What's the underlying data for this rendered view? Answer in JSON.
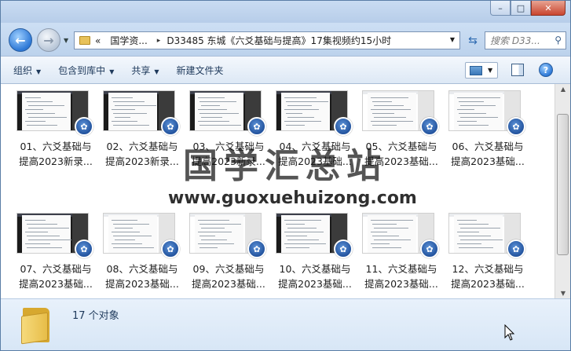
{
  "window": {
    "caption_buttons": {
      "minimize": "–",
      "maximize": "□",
      "close": "✕"
    }
  },
  "nav": {
    "back_icon": "←",
    "forward_icon": "→",
    "breadcrumbs": [
      "«",
      "国学资...",
      "▸",
      "D33485 东城《六爻基础与提高》17集视频约15小时"
    ],
    "search_placeholder": "搜索 D33...",
    "refresh_icon": "⇆",
    "search_icon": "🔍"
  },
  "toolbar": {
    "organize": "组织",
    "include_in_library": "包含到库中",
    "share": "共享",
    "new_folder": "新建文件夹",
    "help": "?"
  },
  "files": [
    {
      "line1": "01、六爻基础与",
      "line2": "提高2023新录...",
      "theme": "dark"
    },
    {
      "line1": "02、六爻基础与",
      "line2": "提高2023新录...",
      "theme": "dark"
    },
    {
      "line1": "03、六爻基础与",
      "line2": "提高2023新录...",
      "theme": "dark"
    },
    {
      "line1": "04、六爻基础与",
      "line2": "提高2023基础...",
      "theme": "dark"
    },
    {
      "line1": "05、六爻基础与",
      "line2": "提高2023基础...",
      "theme": "light"
    },
    {
      "line1": "06、六爻基础与",
      "line2": "提高2023基础...",
      "theme": "light"
    },
    {
      "line1": "07、六爻基础与",
      "line2": "提高2023基础...",
      "theme": "dark"
    },
    {
      "line1": "08、六爻基础与",
      "line2": "提高2023基础...",
      "theme": "light"
    },
    {
      "line1": "09、六爻基础与",
      "line2": "提高2023基础...",
      "theme": "light"
    },
    {
      "line1": "10、六爻基础与",
      "line2": "提高2023基础...",
      "theme": "dark"
    },
    {
      "line1": "11、六爻基础与",
      "line2": "提高2023基础...",
      "theme": "light"
    },
    {
      "line1": "12、六爻基础与",
      "line2": "提高2023基础...",
      "theme": "light"
    }
  ],
  "watermark": {
    "title": "国学汇总站",
    "url": "www.guoxuehuizong.com"
  },
  "status": {
    "item_count": "17 个对象"
  }
}
